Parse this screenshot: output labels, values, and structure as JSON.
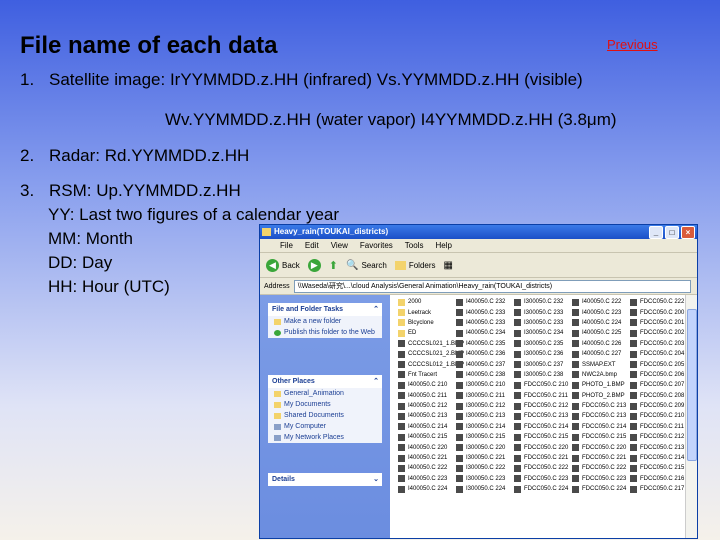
{
  "slide": {
    "title": "File name of each data",
    "previous_link": "Previous",
    "items": [
      {
        "num": "1.",
        "text": "Satellite image: IrYYMMDD.z.HH (infrared) Vs.YYMMDD.z.HH (visible)"
      },
      {
        "num": "",
        "text": "Wv.YYMMDD.z.HH (water vapor) I4YYMMDD.z.HH (3.8μm)"
      },
      {
        "num": "2.",
        "text": "Radar: Rd.YYMMDD.z.HH"
      },
      {
        "num": "3.",
        "text": "RSM: Up.YYMMDD.z.HH"
      }
    ],
    "legend": [
      "YY: Last two figures of a calendar year",
      "MM: Month",
      "DD: Day",
      "HH: Hour (UTC)"
    ]
  },
  "explorer": {
    "window_title": "Heavy_rain(TOUKAI_districts)",
    "menu": [
      "File",
      "Edit",
      "View",
      "Favorites",
      "Tools",
      "Help"
    ],
    "toolbar": {
      "back": "Back",
      "search": "Search",
      "folders": "Folders"
    },
    "address_label": "Address",
    "address_value": "\\\\Waseda\\研究\\...\\cloud Analysis\\General Animation\\Heavy_rain(TOUKAI_districts)",
    "task_panes": [
      {
        "title": "File and Folder Tasks",
        "items": [
          "Make a new folder",
          "Publish this folder to the Web"
        ]
      },
      {
        "title": "Other Places",
        "items": [
          "General_Animation",
          "My Documents",
          "Shared Documents",
          "My Computer",
          "My Network Places"
        ]
      },
      {
        "title": "Details",
        "items": []
      }
    ],
    "file_columns": [
      [
        "2000",
        "Leetrack",
        "Blcyclone",
        "ED",
        "CCCCSL021_1.BMP",
        "CCCCSL021_2.BMP",
        "CCCCSL012_1.BMP",
        "Fnt Tracert",
        "I400050.C 210",
        "I400050.C 211",
        "I400050.C 212",
        "I400050.C 213",
        "I400050.C 214",
        "I400050.C 215",
        "I400050.C 220",
        "I400050.C 221",
        "I400050.C 222",
        "I400050.C 223",
        "I400050.C 224"
      ],
      [
        "I400050.C 232",
        "I400050.C 233",
        "I400050.C 233",
        "I400050.C 234",
        "I400050.C 235",
        "I400050.C 236",
        "I400050.C 237",
        "I400050.C 238",
        "I300050.C 210",
        "I300050.C 211",
        "I300050.C 212",
        "I300050.C 213",
        "I300050.C 214",
        "I300050.C 215",
        "I300050.C 220",
        "I300050.C 221",
        "I300050.C 222",
        "I300050.C 223",
        "I300050.C 224"
      ],
      [
        "I300050.C 232",
        "I300050.C 233",
        "I300050.C 233",
        "I300050.C 234",
        "I300050.C 235",
        "I300050.C 236",
        "I300050.C 237",
        "I300050.C 238",
        "FDCC050.C 210",
        "FDCC050.C 211",
        "FDCC050.C 212",
        "FDCC050.C 213",
        "FDCC050.C 214",
        "FDCC050.C 215",
        "FDCC050.C 220",
        "FDCC050.C 221",
        "FDCC050.C 222",
        "FDCC050.C 223",
        "FDCC050.C 224"
      ],
      [
        "I400050.C 222",
        "I400050.C 223",
        "I400050.C 224",
        "I400050.C 225",
        "I400050.C 226",
        "I400050.C 227",
        "SSMAP.EXT",
        "NWC2A.bmp",
        "PHOTO_1.BMP",
        "PHOTO_2.BMP",
        "FDCC050.C 213",
        "FDCC050.C 213",
        "FDCC050.C 214",
        "FDCC050.C 215",
        "FDCC050.C 220",
        "FDCC050.C 221",
        "FDCC050.C 222",
        "FDCC050.C 223",
        "FDCC050.C 224"
      ],
      [
        "FDCC050.C 222",
        "FDCC050.C 200",
        "FDCC050.C 201",
        "FDCC050.C 202",
        "FDCC050.C 203",
        "FDCC050.C 204",
        "FDCC050.C 205",
        "FDCC050.C 206",
        "FDCC050.C 207",
        "FDCC050.C 208",
        "FDCC050.C 209",
        "FDCC050.C 210",
        "FDCC050.C 211",
        "FDCC050.C 212",
        "FDCC050.C 213",
        "FDCC050.C 214",
        "FDCC050.C 215",
        "FDCC050.C 216",
        "FDCC050.C 217"
      ]
    ]
  }
}
